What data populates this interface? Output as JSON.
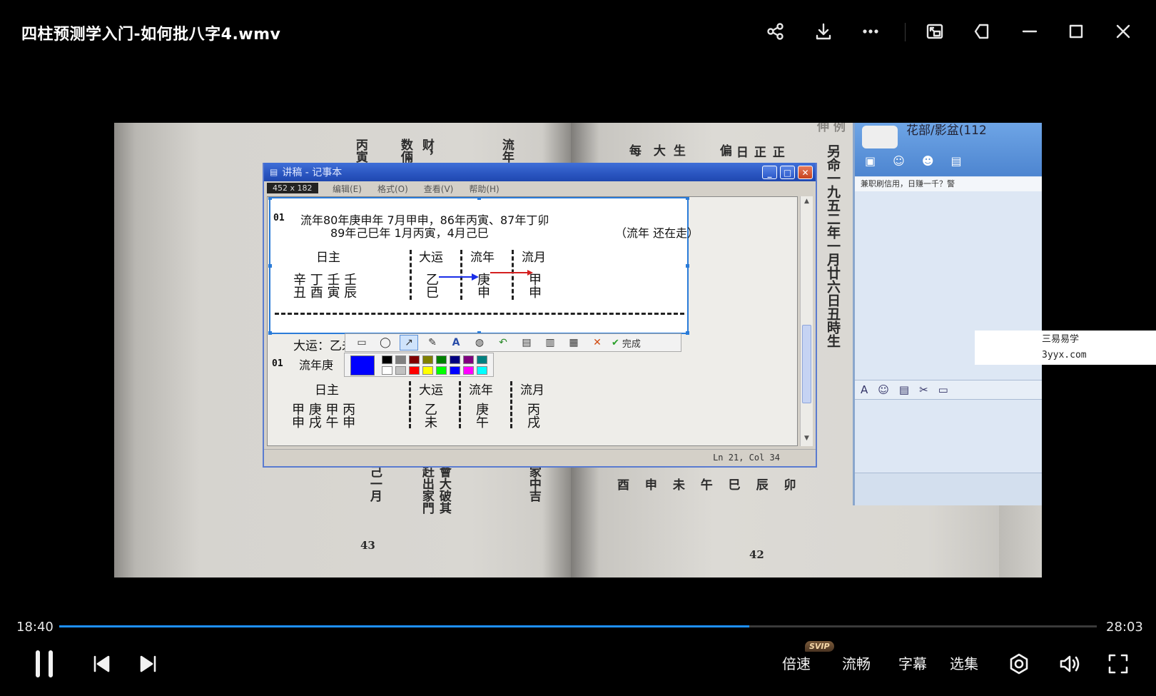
{
  "window": {
    "title": "四柱预测学入门-如何批八字4.wmv",
    "buttons": [
      "share-icon",
      "download-icon",
      "more-icon",
      "pip-icon",
      "pin-icon",
      "minimize-icon",
      "maximize-icon",
      "close-icon"
    ]
  },
  "video": {
    "book": {
      "left_cols": [
        "丙寅",
        "数倆",
        "财，",
        "流年"
      ],
      "left_bottom": [
        "己一月",
        "赶出家門",
        "會大破其",
        "家中吉"
      ],
      "page_left": "43",
      "page_right": "42",
      "right_cols": [
        "每",
        "大",
        "生",
        "偏",
        "日",
        "正",
        "正",
        "另命一九五二年一月廿六日丑時生"
      ],
      "right_row_bottom": "酉 申 未 午 巳 辰 卯",
      "right_top_mark": "伸 例"
    },
    "notepad": {
      "title": "讲稿 - 记事本",
      "menu": [
        "编辑(E)",
        "格式(O)",
        "查看(V)",
        "帮助(H)"
      ],
      "size_badge": "452 x 182",
      "status": "Ln 21, Col 34",
      "block1": {
        "idx": "01",
        "line1": "流年80年庚申年  7月甲申，86年丙寅、87年丁卯",
        "line2": "89年己巳年  1月丙寅，4月己巳",
        "note": "（流年   还在走）",
        "h_rizhu": "日主",
        "h_dayun": "大运",
        "h_liunian": "流年",
        "h_liuyue": "流月",
        "stems": "辛  丁  壬  壬",
        "branches": "丑  酉  寅  辰",
        "dayun_s": "乙",
        "dayun_b": "巳",
        "liunian_s": "庚",
        "liunian_b": "申",
        "liuyue_s": "甲",
        "liuyue_b": "申"
      },
      "block2": {
        "dayun_label": "大运：乙未",
        "idx": "01",
        "line1": "流年庚",
        "h_rizhu": "日主",
        "h_dayun": "大运",
        "h_liunian": "流年",
        "h_liuyue": "流月",
        "stems": "甲  庚  甲  丙",
        "branches": "申  戌  午  申",
        "dayun_s": "乙",
        "dayun_b": "未",
        "liunian_s": "庚",
        "liunian_b": "午",
        "liuyue_s": "丙",
        "liuyue_b": "戌"
      },
      "tools": [
        "rectangle-tool",
        "ellipse-tool",
        "arrow-tool",
        "brush-tool",
        "text-tool",
        "mosaic-tool",
        "undo-tool",
        "save-tool",
        "copy-tool",
        "send-tool",
        "cancel-tool"
      ],
      "done_label": "完成",
      "palette": [
        "#000000",
        "#808080",
        "#800000",
        "#808000",
        "#008000",
        "#000080",
        "#800080",
        "#008080",
        "#ffffff",
        "#c0c0c0",
        "#ff0000",
        "#ffff00",
        "#00ff00",
        "#0000ff",
        "#ff00ff",
        "#00ffff"
      ],
      "current_color": "#0000ff"
    },
    "qq": {
      "title": "花部/影盆(112",
      "ticker": "兼职刷信用，日赚一千？警"
    }
  },
  "watermark": {
    "line1": "三易易学",
    "line2": "3yyx.com"
  },
  "player": {
    "current_time": "18:40",
    "total_time": "28:03",
    "progress": 0.665,
    "speed_label": "倍速",
    "svip_badge": "SVIP",
    "quality_label": "流畅",
    "subtitle_label": "字幕",
    "episodes_label": "选集",
    "accent": "#1e90ff"
  }
}
